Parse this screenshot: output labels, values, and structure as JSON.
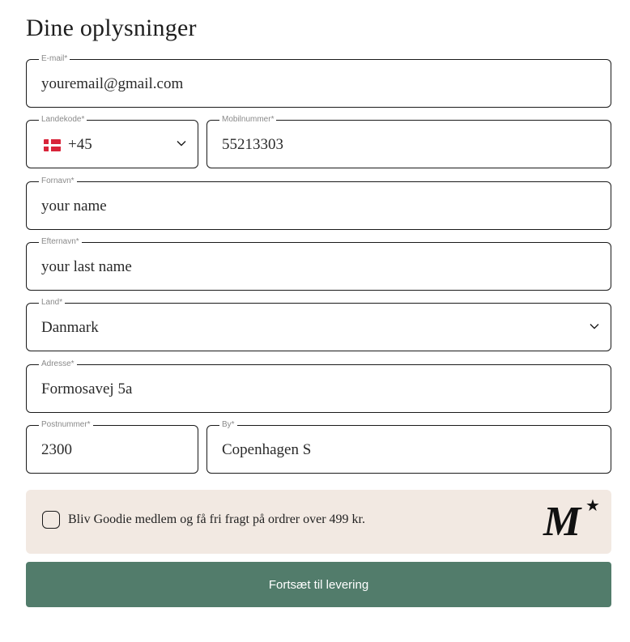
{
  "section_title": "Dine oplysninger",
  "fields": {
    "email": {
      "label": "E-mail*",
      "value": "youremail@gmail.com"
    },
    "country_code": {
      "label": "Landekode*",
      "value": "+45",
      "flag": "denmark-flag-icon"
    },
    "mobile": {
      "label": "Mobilnummer*",
      "value": "55213303"
    },
    "first_name": {
      "label": "Fornavn*",
      "value": "your name"
    },
    "last_name": {
      "label": "Efternavn*",
      "value": "your last name"
    },
    "country": {
      "label": "Land*",
      "value": "Danmark"
    },
    "address": {
      "label": "Adresse*",
      "value": "Formosavej 5a"
    },
    "postal_code": {
      "label": "Postnummer*",
      "value": "2300"
    },
    "city": {
      "label": "By*",
      "value": "Copenhagen S"
    }
  },
  "membership": {
    "checked": false,
    "text": "Bliv Goodie medlem og få fri fragt på ordrer over 499 kr.",
    "logo_letter": "M",
    "logo_star": "★",
    "background": "#f2e9e2"
  },
  "submit": {
    "label": "Fortsæt til levering",
    "color": "#527c6b"
  }
}
